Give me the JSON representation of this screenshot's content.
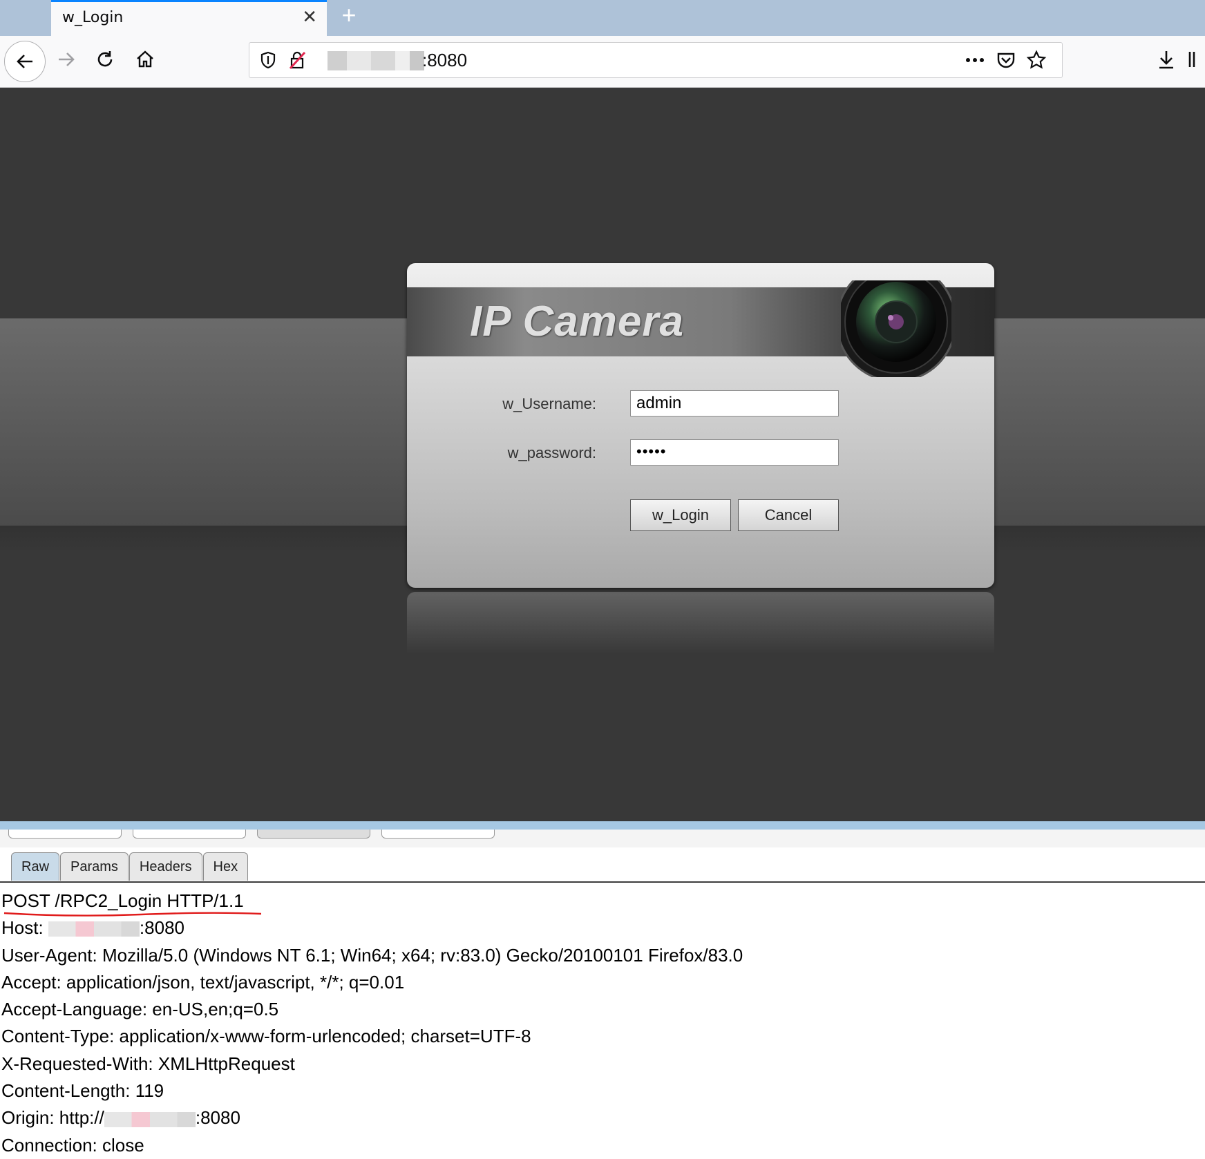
{
  "browser": {
    "tab_title": "w_Login",
    "close_symbol": "✕",
    "new_tab_symbol": "+",
    "url_suffix": ":8080",
    "icons": [
      "back-icon",
      "forward-icon",
      "reload-icon",
      "home-icon",
      "shield-icon",
      "insecure-lock-icon",
      "more-actions-icon",
      "pocket-icon",
      "bookmark-star-icon",
      "download-icon",
      "library-icon"
    ]
  },
  "login": {
    "banner_title": "IP Camera",
    "username_label": "w_Username:",
    "username_value": "admin",
    "password_label": "w_password:",
    "password_value": "•••••",
    "login_button": "w_Login",
    "cancel_button": "Cancel"
  },
  "burp": {
    "tabs": [
      "Raw",
      "Params",
      "Headers",
      "Hex"
    ],
    "active_tab": "Raw",
    "request": {
      "line1": "POST /RPC2_Login HTTP/1.1",
      "host_prefix": "Host: ",
      "host_suffix": ":8080",
      "user_agent": "User-Agent: Mozilla/5.0 (Windows NT 6.1; Win64; x64; rv:83.0) Gecko/20100101 Firefox/83.0",
      "accept": "Accept: application/json, text/javascript, */*; q=0.01",
      "accept_language": "Accept-Language: en-US,en;q=0.5",
      "content_type": "Content-Type: application/x-www-form-urlencoded; charset=UTF-8",
      "x_requested_with": "X-Requested-With: XMLHttpRequest",
      "content_length": "Content-Length: 119",
      "origin_prefix": "Origin: http://",
      "origin_suffix": ":8080",
      "connection": "Connection: close"
    },
    "underline_color": "#e01b1b"
  }
}
